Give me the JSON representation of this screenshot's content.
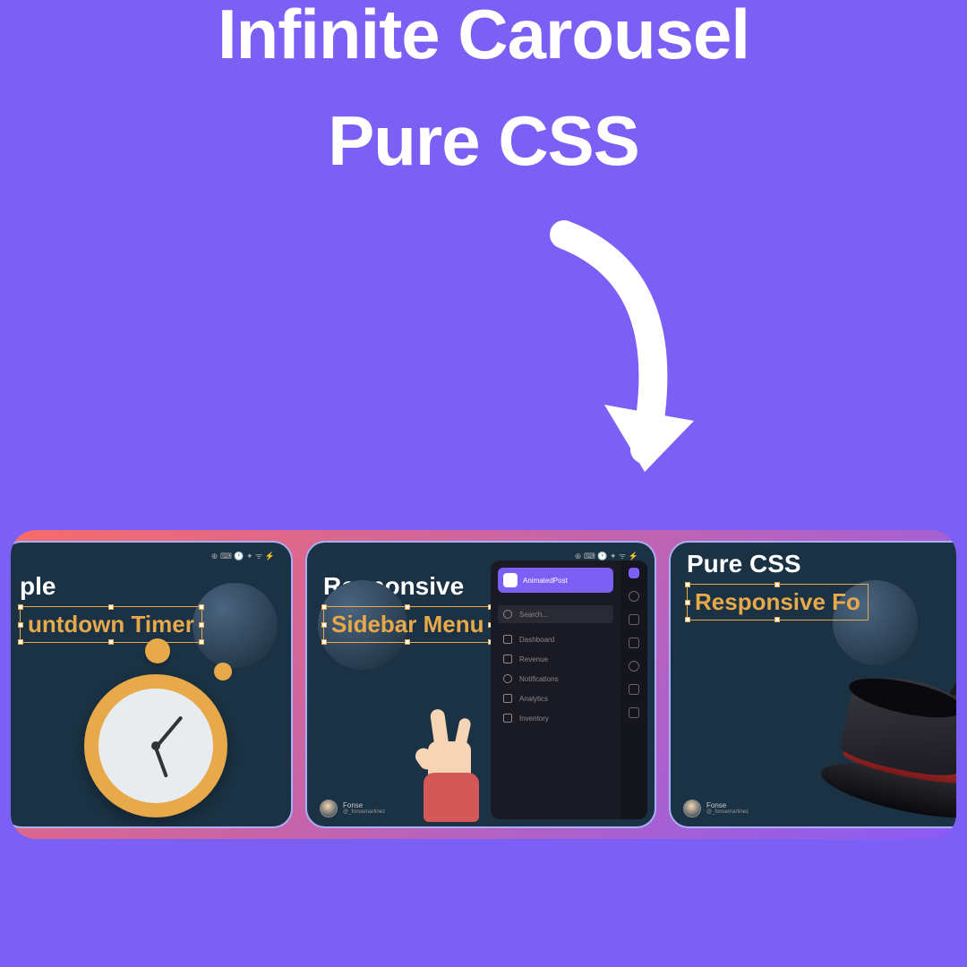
{
  "title": {
    "line1": "Infinite Carousel",
    "line2": "Pure CSS"
  },
  "cards": [
    {
      "title_white": "ple",
      "title_highlight": "untdown Timer",
      "menubar": "⊕  ⌨  🕐  ✦  ᯤ  ⚡"
    },
    {
      "title_white": "Responsive",
      "title_highlight": "Sidebar Menu",
      "menubar": "⊕  ⌨  🕐  ✦  ᯤ  ⚡",
      "sidebar_title": "AnimatedPost",
      "sidebar_items": {
        "search": "Search...",
        "dashboard": "Dashboard",
        "revenue": "Revenue",
        "notifications": "Notifications",
        "analytics": "Analytics",
        "inventory": "Inventory"
      }
    },
    {
      "title_white": "Pure CSS",
      "title_highlight": "Responsive Fo",
      "menubar": "",
      "author_name": "Fonse",
      "author_handle": "@_fonsemartinez"
    }
  ],
  "author_left": {
    "name": "Fonse",
    "handle": "@_fonsemartinez"
  }
}
